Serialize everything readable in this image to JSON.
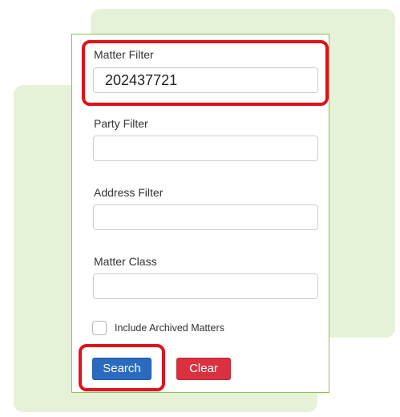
{
  "form": {
    "matter_filter": {
      "label": "Matter Filter",
      "value": "202437721"
    },
    "party_filter": {
      "label": "Party Filter",
      "value": ""
    },
    "address_filter": {
      "label": "Address Filter",
      "value": ""
    },
    "matter_class": {
      "label": "Matter Class",
      "value": ""
    },
    "include_archived": {
      "label": "Include Archived Matters",
      "checked": false
    }
  },
  "buttons": {
    "search_label": "Search",
    "clear_label": "Clear"
  },
  "colors": {
    "background_accent": "#e6f2d7",
    "panel_border": "#8bc34a",
    "highlight": "#e0121b",
    "search_button": "#2a6bc0",
    "clear_button": "#d9313f"
  }
}
